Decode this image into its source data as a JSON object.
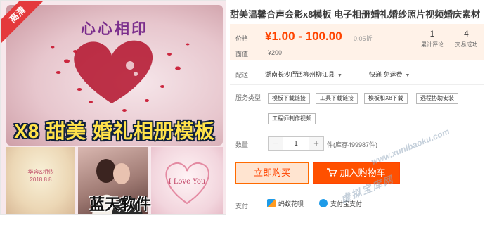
{
  "product": {
    "title": "甜美温馨合声会影x8模板 电子相册婚礼婚纱照片视频婚庆素材"
  },
  "image": {
    "hd_badge": "高清",
    "hero_title": "心心相印",
    "banner_title": "X8 甜美 婚礼相册模板",
    "thumb1_text": "华容&相依",
    "thumb1_date": "2018.8.8",
    "thumb3_text": "I Love You",
    "brand": "蓝天软件"
  },
  "price": {
    "label": "价格",
    "value": "¥1.00 - 100.00",
    "discount": "0.05折",
    "original_label": "面值",
    "original_value": "¥200"
  },
  "stats": [
    {
      "num": "1",
      "label": "累计评论"
    },
    {
      "num": "4",
      "label": "交易成功"
    }
  ],
  "shipping": {
    "label": "配送",
    "from": "湖南长沙 至",
    "destination": "广西柳州柳江县",
    "method": "快递 免运费"
  },
  "service": {
    "label": "服务类型",
    "options": [
      "模板下载链接",
      "工具下载链接",
      "模板和X8下载",
      "远程协助安装",
      "工程师制作视频"
    ]
  },
  "quantity": {
    "label": "数量",
    "value": "1",
    "minus": "−",
    "plus": "+",
    "stock": "件(库存499987件)"
  },
  "actions": {
    "buy_now": "立即购买",
    "add_cart": "加入购物车"
  },
  "payment": {
    "label": "支付",
    "methods": [
      "蚂蚁花呗",
      "支付宝支付"
    ]
  },
  "watermark": {
    "url": "www.xunibaoku.com",
    "text": "虚拟宝库网"
  },
  "colors": {
    "accent": "#ff4400",
    "cart_button": "#ff5000",
    "hd_badge": "#e4393c",
    "banner_text": "#ffe24a",
    "hero_title": "#7a2d8c"
  }
}
